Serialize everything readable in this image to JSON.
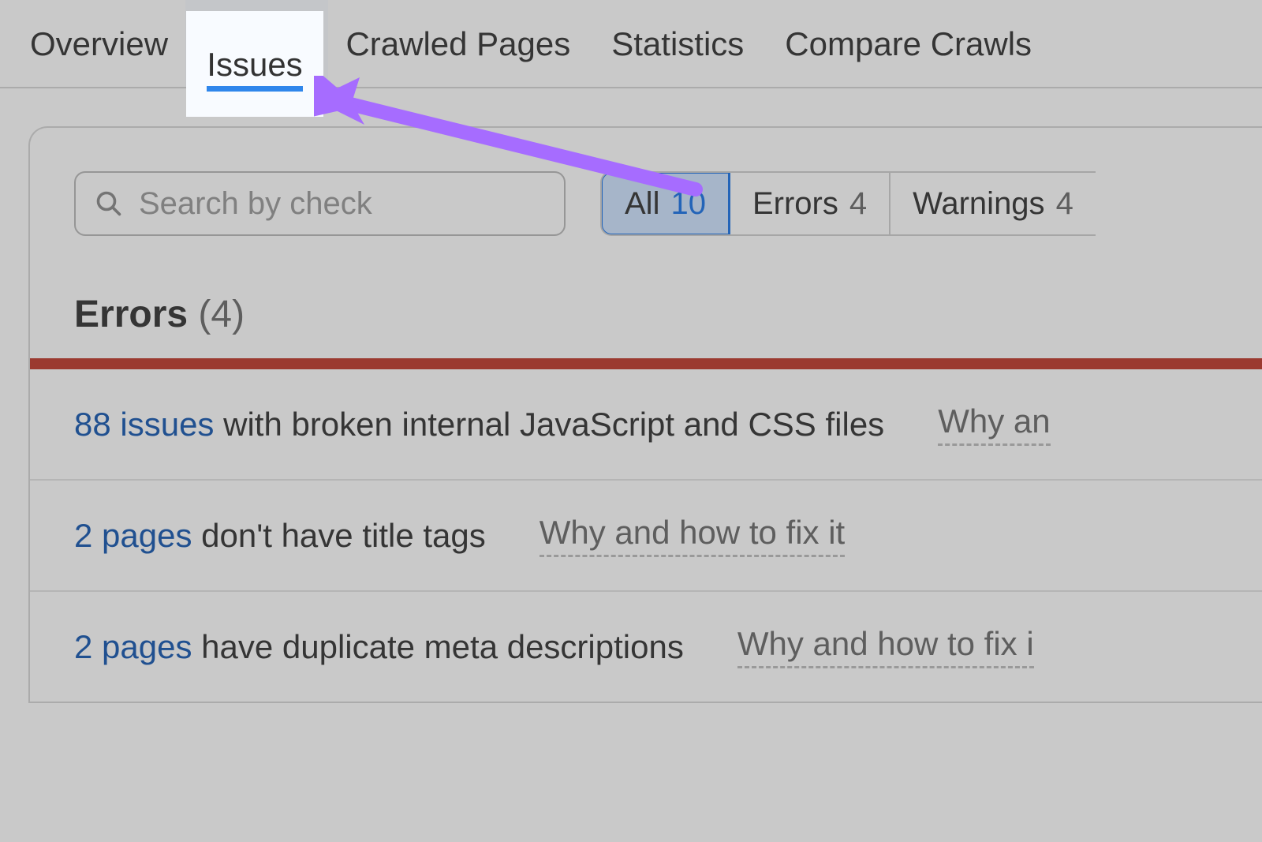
{
  "tabs": {
    "overview": "Overview",
    "issues": "Issues",
    "crawled_pages": "Crawled Pages",
    "statistics": "Statistics",
    "compare_crawls": "Compare Crawls"
  },
  "search": {
    "placeholder": "Search by check"
  },
  "filters": {
    "all": {
      "label": "All",
      "count": "10"
    },
    "errors": {
      "label": "Errors",
      "count": "4"
    },
    "warnings": {
      "label": "Warnings",
      "count": "4"
    }
  },
  "section": {
    "label": "Errors",
    "count": "(4)"
  },
  "rows": [
    {
      "count_text": "88 issues",
      "desc": " with broken internal JavaScript and CSS files",
      "fix": "Why an"
    },
    {
      "count_text": "2 pages",
      "desc": " don't have title tags",
      "fix": "Why and how to fix it"
    },
    {
      "count_text": "2 pages",
      "desc": " have duplicate meta descriptions",
      "fix": "Why and how to fix i"
    }
  ],
  "colors": {
    "accent": "#2f86eb",
    "error_bar": "#c0392b",
    "annotation": "#a66cff"
  }
}
